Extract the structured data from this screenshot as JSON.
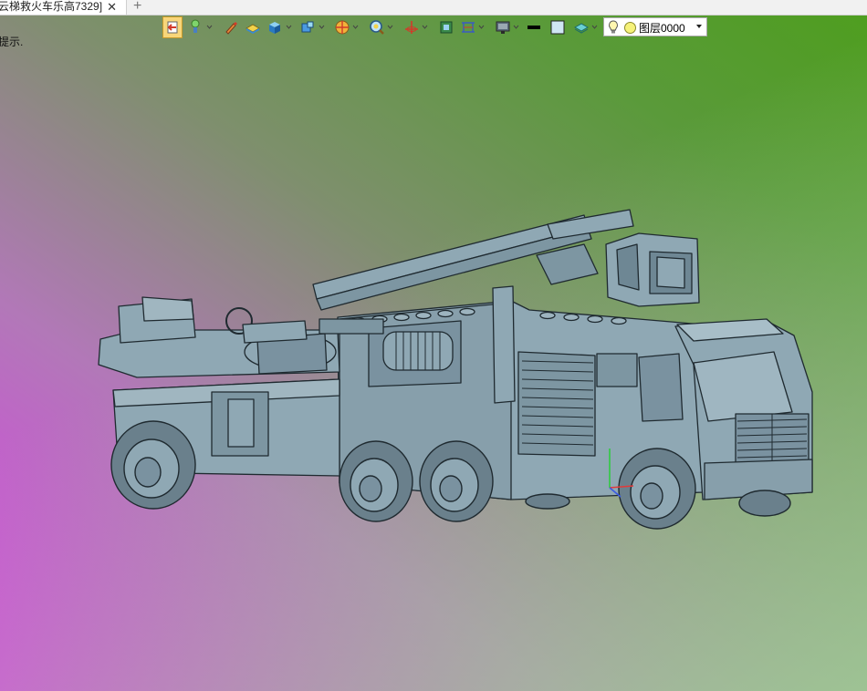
{
  "tab": {
    "title": "云梯救火车乐高7329]",
    "close_glyph": "✕",
    "new_tab_glyph": "+"
  },
  "hint_text": "提示.",
  "toolbar": {
    "tools": [
      "view-arrow-icon",
      "light-icon",
      "pen-icon",
      "box-shade-icon",
      "solid-cube-icon",
      "cube-display-icon",
      "section-icon",
      "zoom-icon",
      "axis-icon",
      "fit-icon",
      "measure-icon",
      "monitor-icon",
      "color-black-icon",
      "color-swatch-icon",
      "layer-stack-icon"
    ],
    "layer_select": {
      "value": "图层0000"
    }
  },
  "colors": {
    "model_fill": "#8fa8b4",
    "model_stroke": "#1f2a30",
    "toolbar_highlight": "#f8d67a"
  }
}
